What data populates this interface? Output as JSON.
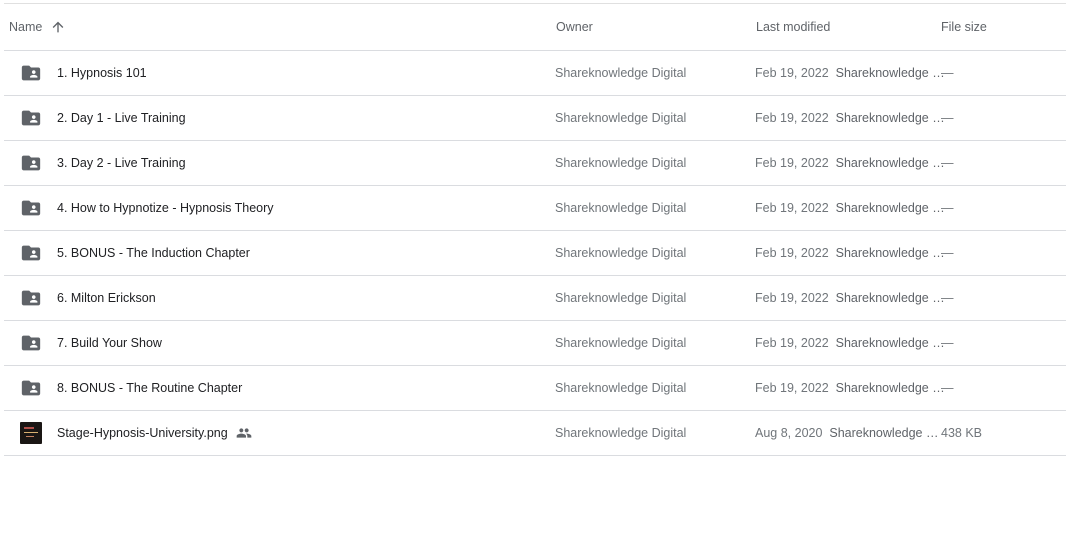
{
  "header": {
    "name": "Name",
    "owner": "Owner",
    "last_modified": "Last modified",
    "file_size": "File size"
  },
  "rows": [
    {
      "name": "1. Hypnosis 101",
      "owner": "Shareknowledge Digital",
      "date": "Feb 19, 2022",
      "modified_by": "Shareknowledge …",
      "size": "—"
    },
    {
      "name": "2. Day 1 - Live Training",
      "owner": "Shareknowledge Digital",
      "date": "Feb 19, 2022",
      "modified_by": "Shareknowledge …",
      "size": "—"
    },
    {
      "name": "3. Day 2 - Live Training",
      "owner": "Shareknowledge Digital",
      "date": "Feb 19, 2022",
      "modified_by": "Shareknowledge …",
      "size": "—"
    },
    {
      "name": "4. How to Hypnotize - Hypnosis Theory",
      "owner": "Shareknowledge Digital",
      "date": "Feb 19, 2022",
      "modified_by": "Shareknowledge …",
      "size": "—"
    },
    {
      "name": "5. BONUS - The Induction Chapter",
      "owner": "Shareknowledge Digital",
      "date": "Feb 19, 2022",
      "modified_by": "Shareknowledge …",
      "size": "—"
    },
    {
      "name": "6. Milton Erickson",
      "owner": "Shareknowledge Digital",
      "date": "Feb 19, 2022",
      "modified_by": "Shareknowledge …",
      "size": "—"
    },
    {
      "name": "7. Build Your Show",
      "owner": "Shareknowledge Digital",
      "date": "Feb 19, 2022",
      "modified_by": "Shareknowledge …",
      "size": "—"
    },
    {
      "name": "8. BONUS - The Routine Chapter",
      "owner": "Shareknowledge Digital",
      "date": "Feb 19, 2022",
      "modified_by": "Shareknowledge …",
      "size": "—"
    },
    {
      "name": "Stage-Hypnosis-University.png",
      "owner": "Shareknowledge Digital",
      "date": "Aug 8, 2020",
      "modified_by": "Shareknowledge …",
      "size": "438 KB"
    }
  ],
  "icons": {
    "folder": "shared-folder-icon",
    "image": "image-thumbnail",
    "shared": "people-icon",
    "sort": "arrow-up-icon"
  },
  "colors": {
    "folder_icon": "#5f6368",
    "divider": "#dadce0"
  }
}
